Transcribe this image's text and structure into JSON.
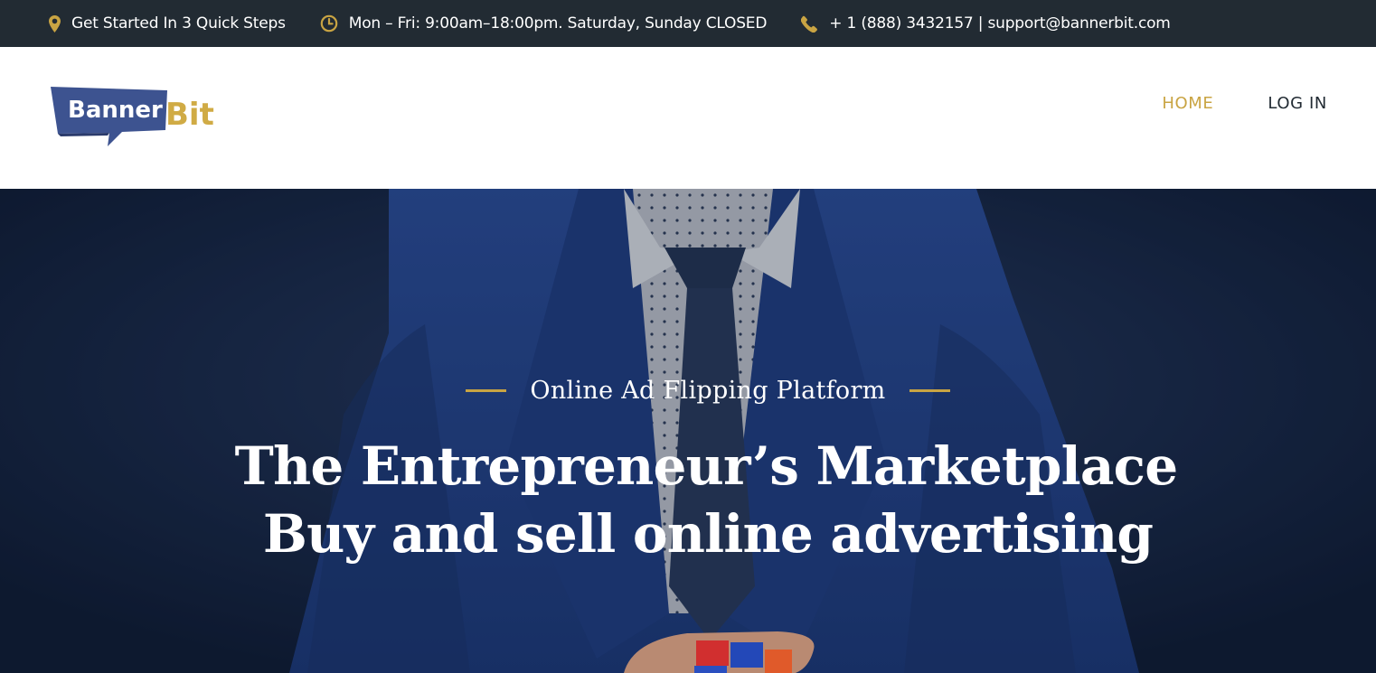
{
  "topbar": {
    "steps_text": "Get Started In 3 Quick Steps",
    "hours_text": "Mon – Fri: 9:00am–18:00pm. Saturday, Sunday CLOSED",
    "contact_text": "+ 1 (888) 3432157 | support@bannerbit.com",
    "icons": [
      "map-pin-icon",
      "clock-icon",
      "phone-icon"
    ]
  },
  "logo": {
    "word1": "Banner",
    "word2": "Bit"
  },
  "nav": {
    "home": "HOME",
    "login": "LOG IN",
    "active": "home"
  },
  "hero": {
    "eyebrow": "Online Ad Flipping Platform",
    "headline_line1": "The Entrepreneur’s Marketplace",
    "headline_line2": "Buy and sell online advertising"
  },
  "colors": {
    "topbar_bg": "#222b33",
    "accent_gold": "#c9a443",
    "nav_text": "#222b33",
    "hero_bg": "#12203a",
    "logo_blue": "#3d5390"
  }
}
